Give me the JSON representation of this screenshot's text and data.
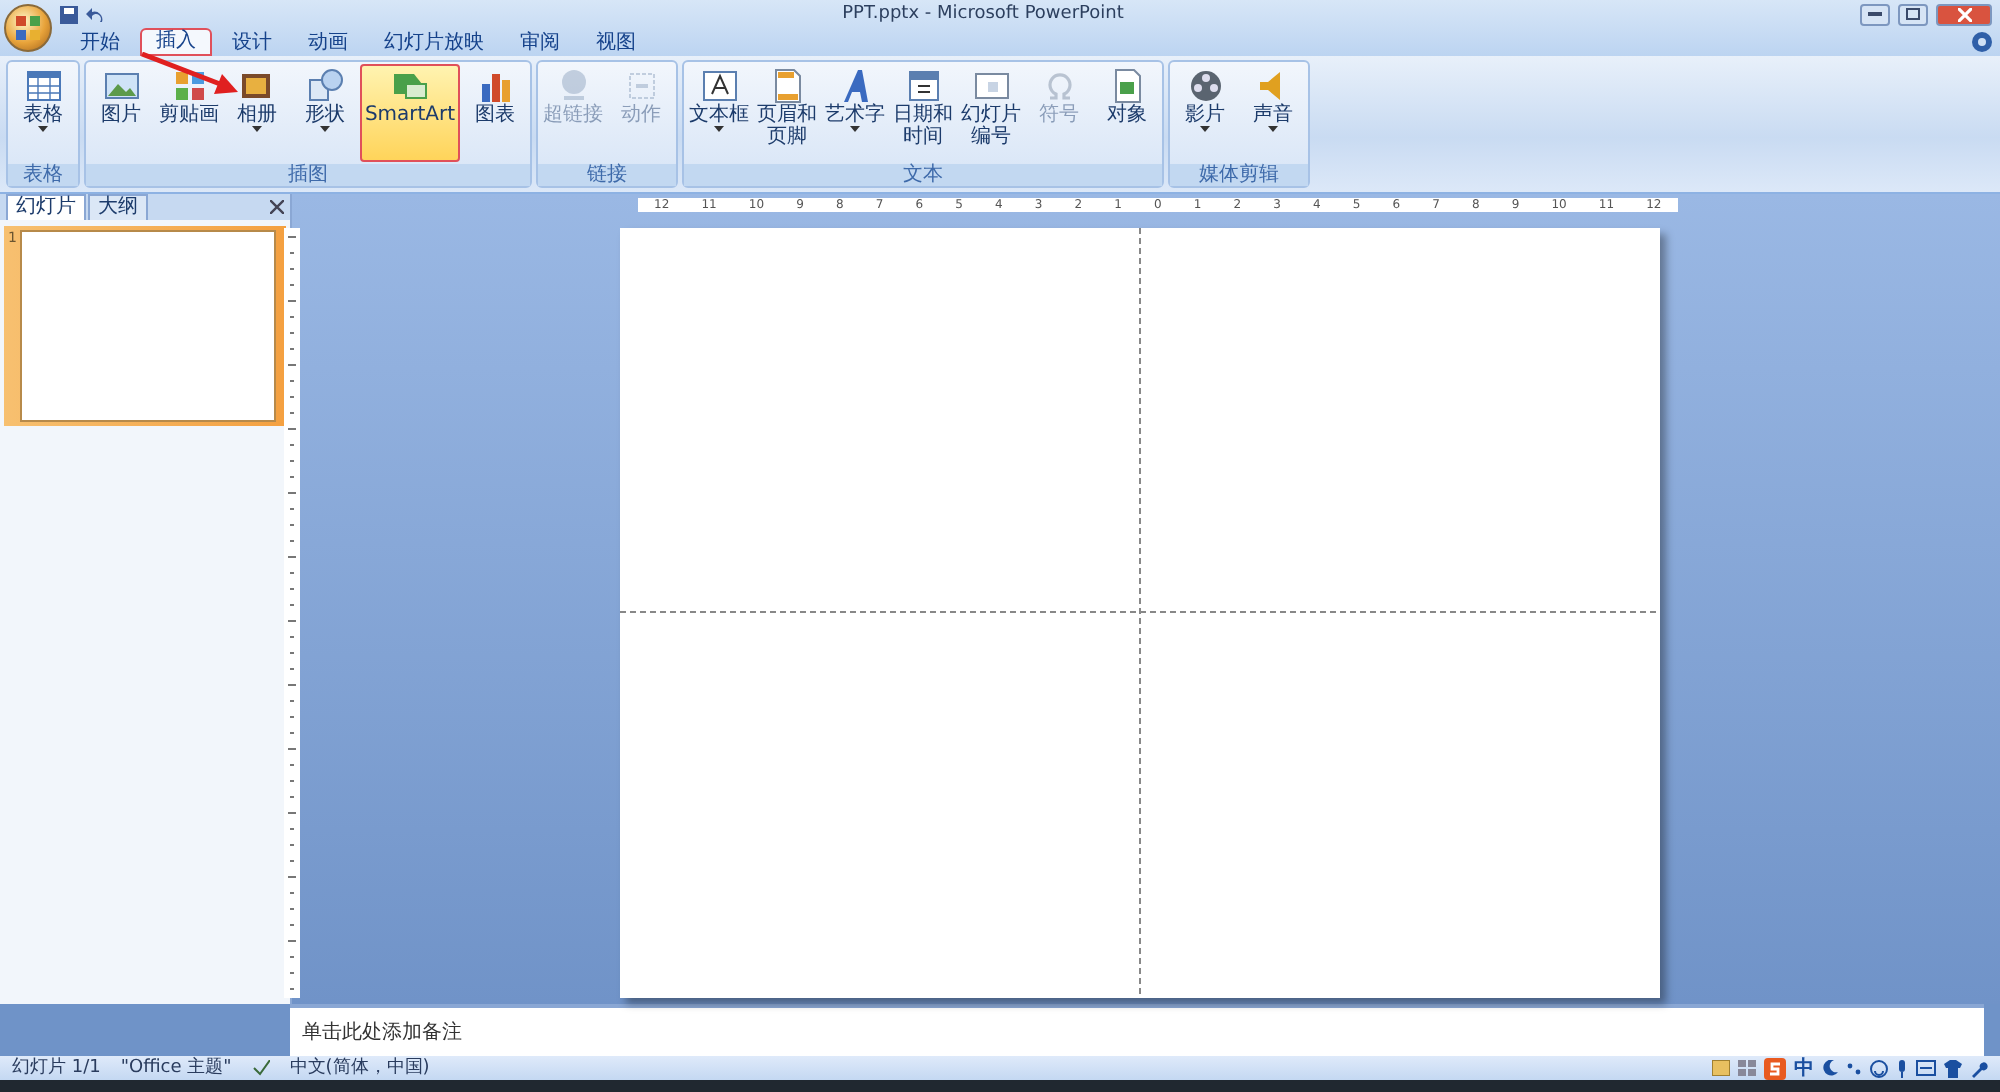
{
  "window": {
    "title": "PPT.pptx - Microsoft PowerPoint"
  },
  "ribbon_tabs": [
    {
      "label": "开始",
      "selected": false,
      "annotated": false
    },
    {
      "label": "插入",
      "selected": true,
      "annotated": true
    },
    {
      "label": "设计",
      "selected": false,
      "annotated": false
    },
    {
      "label": "动画",
      "selected": false,
      "annotated": false
    },
    {
      "label": "幻灯片放映",
      "selected": false,
      "annotated": false
    },
    {
      "label": "审阅",
      "selected": false,
      "annotated": false
    },
    {
      "label": "视图",
      "selected": false,
      "annotated": false
    }
  ],
  "ribbon_groups": [
    {
      "label": "表格",
      "items": [
        {
          "label": "表格",
          "kind": "table",
          "dropdown": true,
          "disabled": false,
          "highlighted": false,
          "annotated": false
        }
      ]
    },
    {
      "label": "插图",
      "items": [
        {
          "label": "图片",
          "kind": "picture",
          "dropdown": false,
          "disabled": false,
          "highlighted": false,
          "annotated": false
        },
        {
          "label": "剪贴画",
          "kind": "clipart",
          "dropdown": false,
          "disabled": false,
          "highlighted": false,
          "annotated": false
        },
        {
          "label": "相册",
          "kind": "album",
          "dropdown": true,
          "disabled": false,
          "highlighted": false,
          "annotated": false
        },
        {
          "label": "形状",
          "kind": "shapes",
          "dropdown": true,
          "disabled": false,
          "highlighted": false,
          "annotated": false
        },
        {
          "label": "SmartArt",
          "kind": "smartart",
          "dropdown": false,
          "disabled": false,
          "highlighted": true,
          "annotated": true
        },
        {
          "label": "图表",
          "kind": "chart",
          "dropdown": false,
          "disabled": false,
          "highlighted": false,
          "annotated": false
        }
      ]
    },
    {
      "label": "链接",
      "items": [
        {
          "label": "超链接",
          "kind": "hyperlink",
          "dropdown": false,
          "disabled": true,
          "highlighted": false,
          "annotated": false
        },
        {
          "label": "动作",
          "kind": "action",
          "dropdown": false,
          "disabled": true,
          "highlighted": false,
          "annotated": false
        }
      ]
    },
    {
      "label": "文本",
      "items": [
        {
          "label": "文本框",
          "kind": "textbox",
          "dropdown": true,
          "disabled": false,
          "highlighted": false,
          "annotated": false
        },
        {
          "label": "页眉和页脚",
          "kind": "header",
          "dropdown": false,
          "disabled": false,
          "highlighted": false,
          "annotated": false
        },
        {
          "label": "艺术字",
          "kind": "wordart",
          "dropdown": true,
          "disabled": false,
          "highlighted": false,
          "annotated": false
        },
        {
          "label": "日期和时间",
          "kind": "datetime",
          "dropdown": false,
          "disabled": false,
          "highlighted": false,
          "annotated": false
        },
        {
          "label": "幻灯片编号",
          "kind": "slidenumber",
          "dropdown": false,
          "disabled": false,
          "highlighted": false,
          "annotated": false
        },
        {
          "label": "符号",
          "kind": "symbol",
          "dropdown": false,
          "disabled": true,
          "highlighted": false,
          "annotated": false
        },
        {
          "label": "对象",
          "kind": "object",
          "dropdown": false,
          "disabled": false,
          "highlighted": false,
          "annotated": false
        }
      ]
    },
    {
      "label": "媒体剪辑",
      "items": [
        {
          "label": "影片",
          "kind": "movie",
          "dropdown": true,
          "disabled": false,
          "highlighted": false,
          "annotated": false
        },
        {
          "label": "声音",
          "kind": "sound",
          "dropdown": true,
          "disabled": false,
          "highlighted": false,
          "annotated": false
        }
      ]
    }
  ],
  "annotation": {
    "arrow": true
  },
  "panel": {
    "tabs": [
      {
        "label": "幻灯片",
        "selected": true
      },
      {
        "label": "大纲",
        "selected": false
      }
    ],
    "thumbnails": [
      {
        "number": "1",
        "selected": true
      }
    ]
  },
  "ruler": {
    "labels": [
      "12",
      "11",
      "10",
      "9",
      "8",
      "7",
      "6",
      "5",
      "4",
      "3",
      "2",
      "1",
      "0",
      "1",
      "2",
      "3",
      "4",
      "5",
      "6",
      "7",
      "8",
      "9",
      "10",
      "11",
      "12"
    ]
  },
  "notes": {
    "placeholder": "单击此处添加备注"
  },
  "status_bar": {
    "items": [
      "幻灯片 1/1",
      "\"Office 主题\"",
      "中文(简体，中国)"
    ],
    "ime_mode": "中"
  }
}
